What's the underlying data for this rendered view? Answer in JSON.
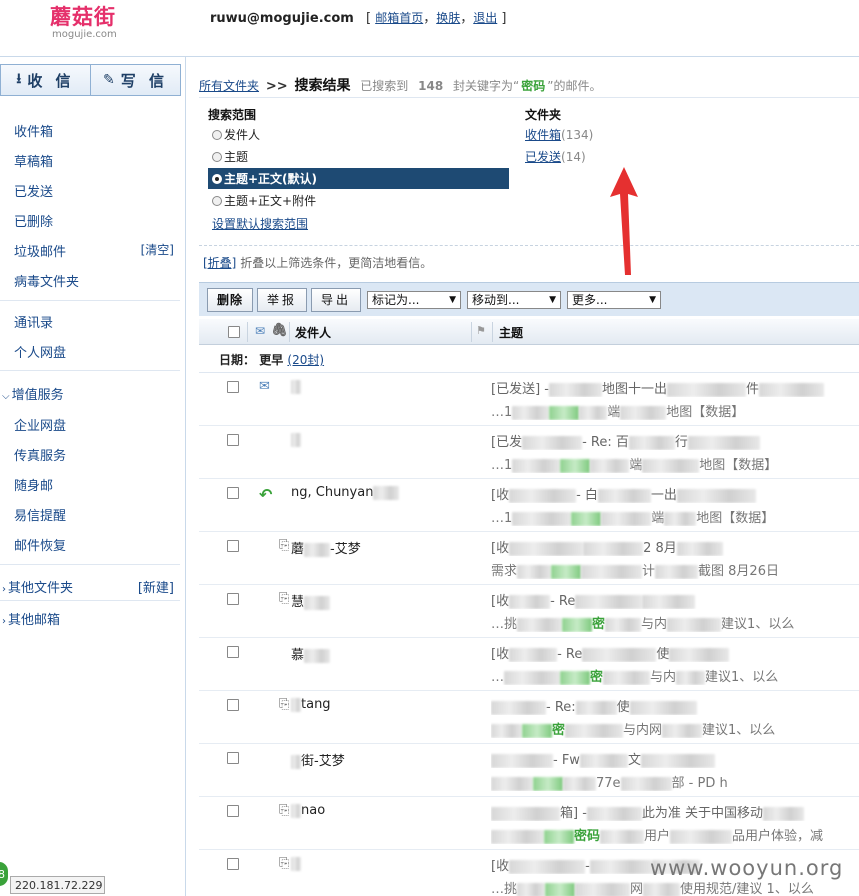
{
  "header": {
    "logo_text": "蘑菇街",
    "logo_sub": "mogujie.com",
    "email": "ruwu@mogujie.com",
    "links_open": "[",
    "links": [
      "邮箱首页",
      "换肤",
      "退出"
    ],
    "links_close": "]",
    "sep": "，"
  },
  "sidebar": {
    "receive_label": "收 信",
    "write_label": "写 信",
    "receive_icon": "download-arrow-icon",
    "write_icon": "pencil-square-icon",
    "folders": [
      "收件箱",
      "草稿箱",
      "已发送",
      "已删除",
      "垃圾邮件",
      "病毒文件夹"
    ],
    "trash_action": "[清空]",
    "contacts": [
      "通讯录",
      "个人网盘"
    ],
    "value_added_title": "增值服务",
    "value_added": [
      "企业网盘",
      "传真服务",
      "随身邮",
      "易信提醒",
      "邮件恢复"
    ],
    "other_folders": "其他文件夹",
    "new_folder": "[新建]",
    "other_mailboxes": "其他邮箱",
    "ip": "220.181.72.229",
    "green_badge": "8"
  },
  "breadcrumb": {
    "home": "所有文件夹",
    "sep": ">>",
    "title": "搜索结果",
    "prefix": "已搜索到",
    "count": "148",
    "middle": "封关键字为“",
    "keyword": "密码",
    "suffix": "”的邮件。"
  },
  "filters": {
    "scope_title": "搜索范围",
    "options": [
      "发件人",
      "主题",
      "主题+正文(默认)",
      "主题+正文+附件"
    ],
    "selected_index": 2,
    "set_default": "设置默认搜索范围",
    "folder_title": "文件夹",
    "folders": [
      {
        "name": "收件箱",
        "count": "(134)"
      },
      {
        "name": "已发送",
        "count": "(14)"
      }
    ],
    "collapse_link": "[折叠]",
    "collapse_text": "折叠以上筛选条件，更简洁地看信。"
  },
  "toolbar": {
    "delete": "删除",
    "report": "举报",
    "export": "导出",
    "mark_as": "标记为...",
    "move_to": "移动到...",
    "more": "更多..."
  },
  "table": {
    "col_from": "发件人",
    "col_subject": "主题",
    "group_label": "日期：",
    "group_value": "更早",
    "group_count": "(20封)"
  },
  "rows": [
    {
      "icon": "sent-check-icon",
      "att": "",
      "from": "",
      "subject_pre": "[已发送] -",
      "subject_post": "地图十一出",
      "subject_tail": "件",
      "snip_pre": "…1",
      "snip_kw": "",
      "snip_post": "端",
      "snip_tail": "地图【数据】"
    },
    {
      "icon": "",
      "att": "",
      "from": "",
      "subject_pre": "[已发",
      "subject_post": "- Re: 百",
      "subject_tail": "行",
      "snip_pre": "…1",
      "snip_kw": "",
      "snip_post": "端",
      "snip_tail": "地图【数据】"
    },
    {
      "icon": "reply-arrow-icon",
      "att": "",
      "from": "ng, Chunyan",
      "subject_pre": "[收",
      "subject_post": "- 白",
      "subject_tail": "一出",
      "snip_pre": "…1",
      "snip_kw": "",
      "snip_post": "端",
      "snip_tail": "地图【数据】"
    },
    {
      "icon": "",
      "att": "paperclip-icon",
      "from": "蘑",
      "from_tail": "-艾梦",
      "subject_pre": "[收",
      "subject_post": "",
      "subject_tail": "2 8月",
      "snip_pre": "需求",
      "snip_kw": "",
      "snip_post": "计",
      "snip_tail": "截图 8月26日"
    },
    {
      "icon": "",
      "att": "paperclip-icon",
      "from": "慧",
      "from_tail": "",
      "subject_pre": "[收",
      "subject_post": "- Re",
      "subject_tail": "",
      "snip_pre": "…挑",
      "snip_kw": "密",
      "snip_post": "与内",
      "snip_tail": "建议1、以么"
    },
    {
      "icon": "",
      "att": "",
      "from": "慕",
      "from_tail": "",
      "subject_pre": "[收",
      "subject_post": "- Re",
      "subject_tail": "使",
      "snip_pre": "…",
      "snip_kw": "密",
      "snip_post": "与内",
      "snip_tail": "建议1、以么"
    },
    {
      "icon": "",
      "att": "paperclip-icon",
      "from": "",
      "from_tail": "tang",
      "subject_pre": "",
      "subject_post": "- Re:",
      "subject_tail": "使",
      "snip_pre": "",
      "snip_kw": "密",
      "snip_post": "与内网",
      "snip_tail": "建议1、以么"
    },
    {
      "icon": "",
      "att": "",
      "from": "",
      "from_tail": "街-艾梦",
      "subject_pre": "",
      "subject_post": "- Fw",
      "subject_tail": "文",
      "snip_pre": "",
      "snip_kw": "",
      "snip_post": "77e",
      "snip_tail": "部 - PD h"
    },
    {
      "icon": "",
      "att": "paperclip-icon",
      "from": "",
      "from_tail": "nao",
      "subject_pre": "",
      "subject_post": "箱] -",
      "subject_tail": "此为准 关于中国移动",
      "snip_pre": "",
      "snip_kw": "密码",
      "snip_post": "用户",
      "snip_tail": "品用户体验，减"
    },
    {
      "icon": "",
      "att": "paperclip-icon",
      "from": "",
      "from_tail": "",
      "subject_pre": "[收",
      "subject_post": "-",
      "subject_tail": "",
      "snip_pre": "…挑",
      "snip_kw": "",
      "snip_post": "网",
      "snip_tail": "使用规范/建议 1、以么"
    }
  ],
  "watermark": "www.wooyun.org",
  "colors": {
    "brand_pink": "#e5306b",
    "selected_blue": "#1e4a73",
    "keyword_green": "#3aa23a",
    "link_blue": "#1a4a8a",
    "annotation_red": "#e53030"
  }
}
